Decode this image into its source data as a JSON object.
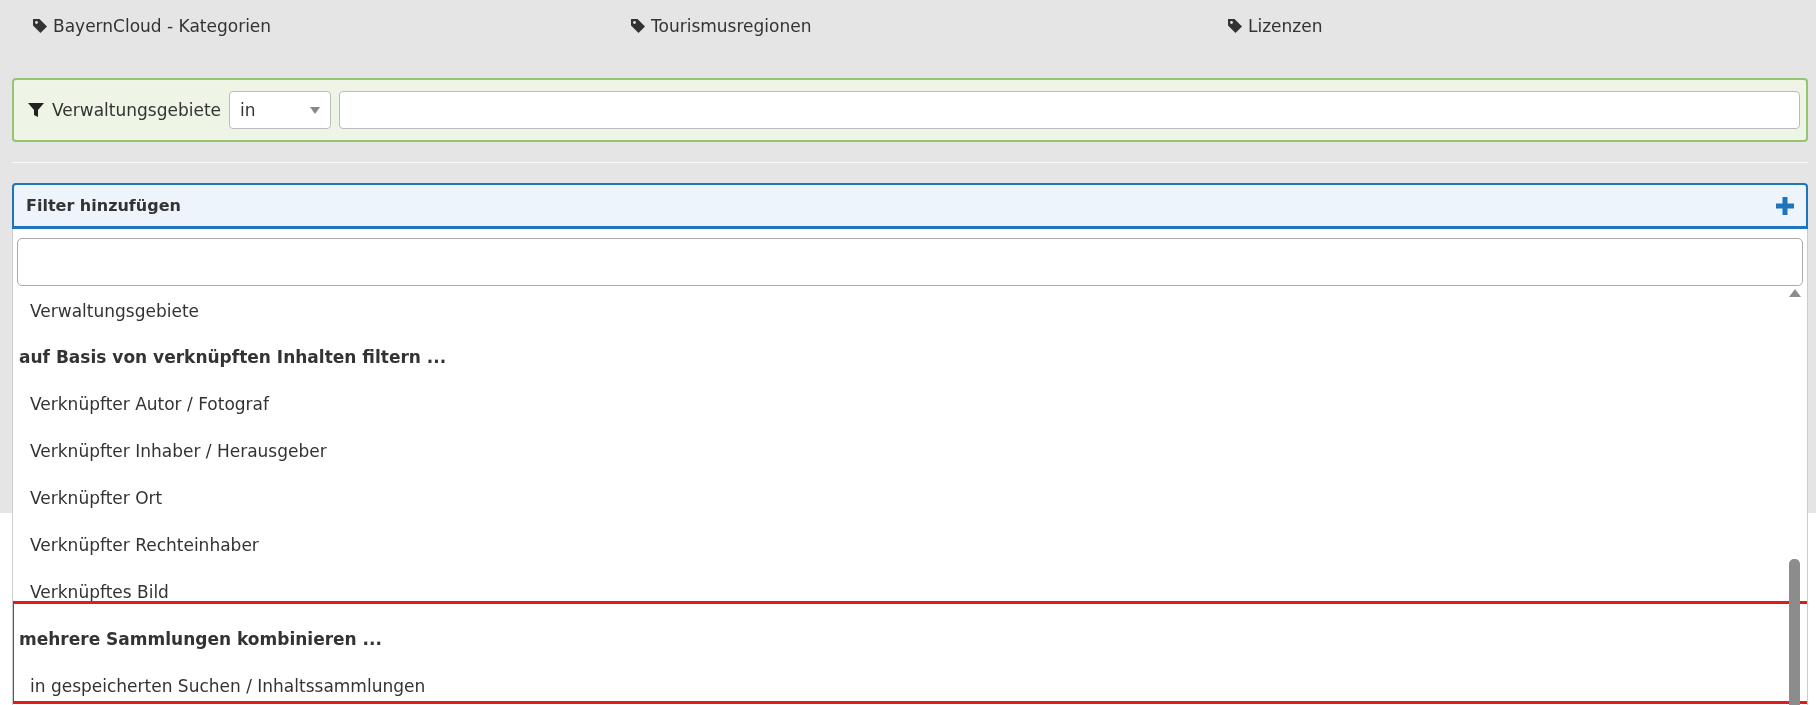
{
  "tags": [
    {
      "label": "BayernCloud - Kategorien"
    },
    {
      "label": "Tourismusregionen"
    },
    {
      "label": "Lizenzen"
    }
  ],
  "active_filter": {
    "label": "Verwaltungsgebiete",
    "operator": "in"
  },
  "add_filter": {
    "title": "Filter hinzufügen",
    "expanded": true,
    "options": [
      {
        "kind": "option",
        "label": "Verwaltungsgebiete",
        "highlighted": false
      },
      {
        "kind": "group",
        "label": "auf Basis von verknüpften Inhalten filtern ...",
        "highlighted": false
      },
      {
        "kind": "option",
        "label": "Verknüpfter Autor / Fotograf",
        "highlighted": false
      },
      {
        "kind": "option",
        "label": "Verknüpfter Inhaber / Herausgeber",
        "highlighted": false
      },
      {
        "kind": "option",
        "label": "Verknüpfter Ort",
        "highlighted": false
      },
      {
        "kind": "option",
        "label": "Verknüpfter Rechteinhaber",
        "highlighted": false
      },
      {
        "kind": "option",
        "label": "Verknüpftes Bild",
        "highlighted": false
      },
      {
        "kind": "group",
        "label": "mehrere Sammlungen kombinieren ...",
        "highlighted": true
      },
      {
        "kind": "option",
        "label": "in gespeicherten Suchen / Inhaltssammlungen",
        "highlighted": true
      }
    ]
  }
}
